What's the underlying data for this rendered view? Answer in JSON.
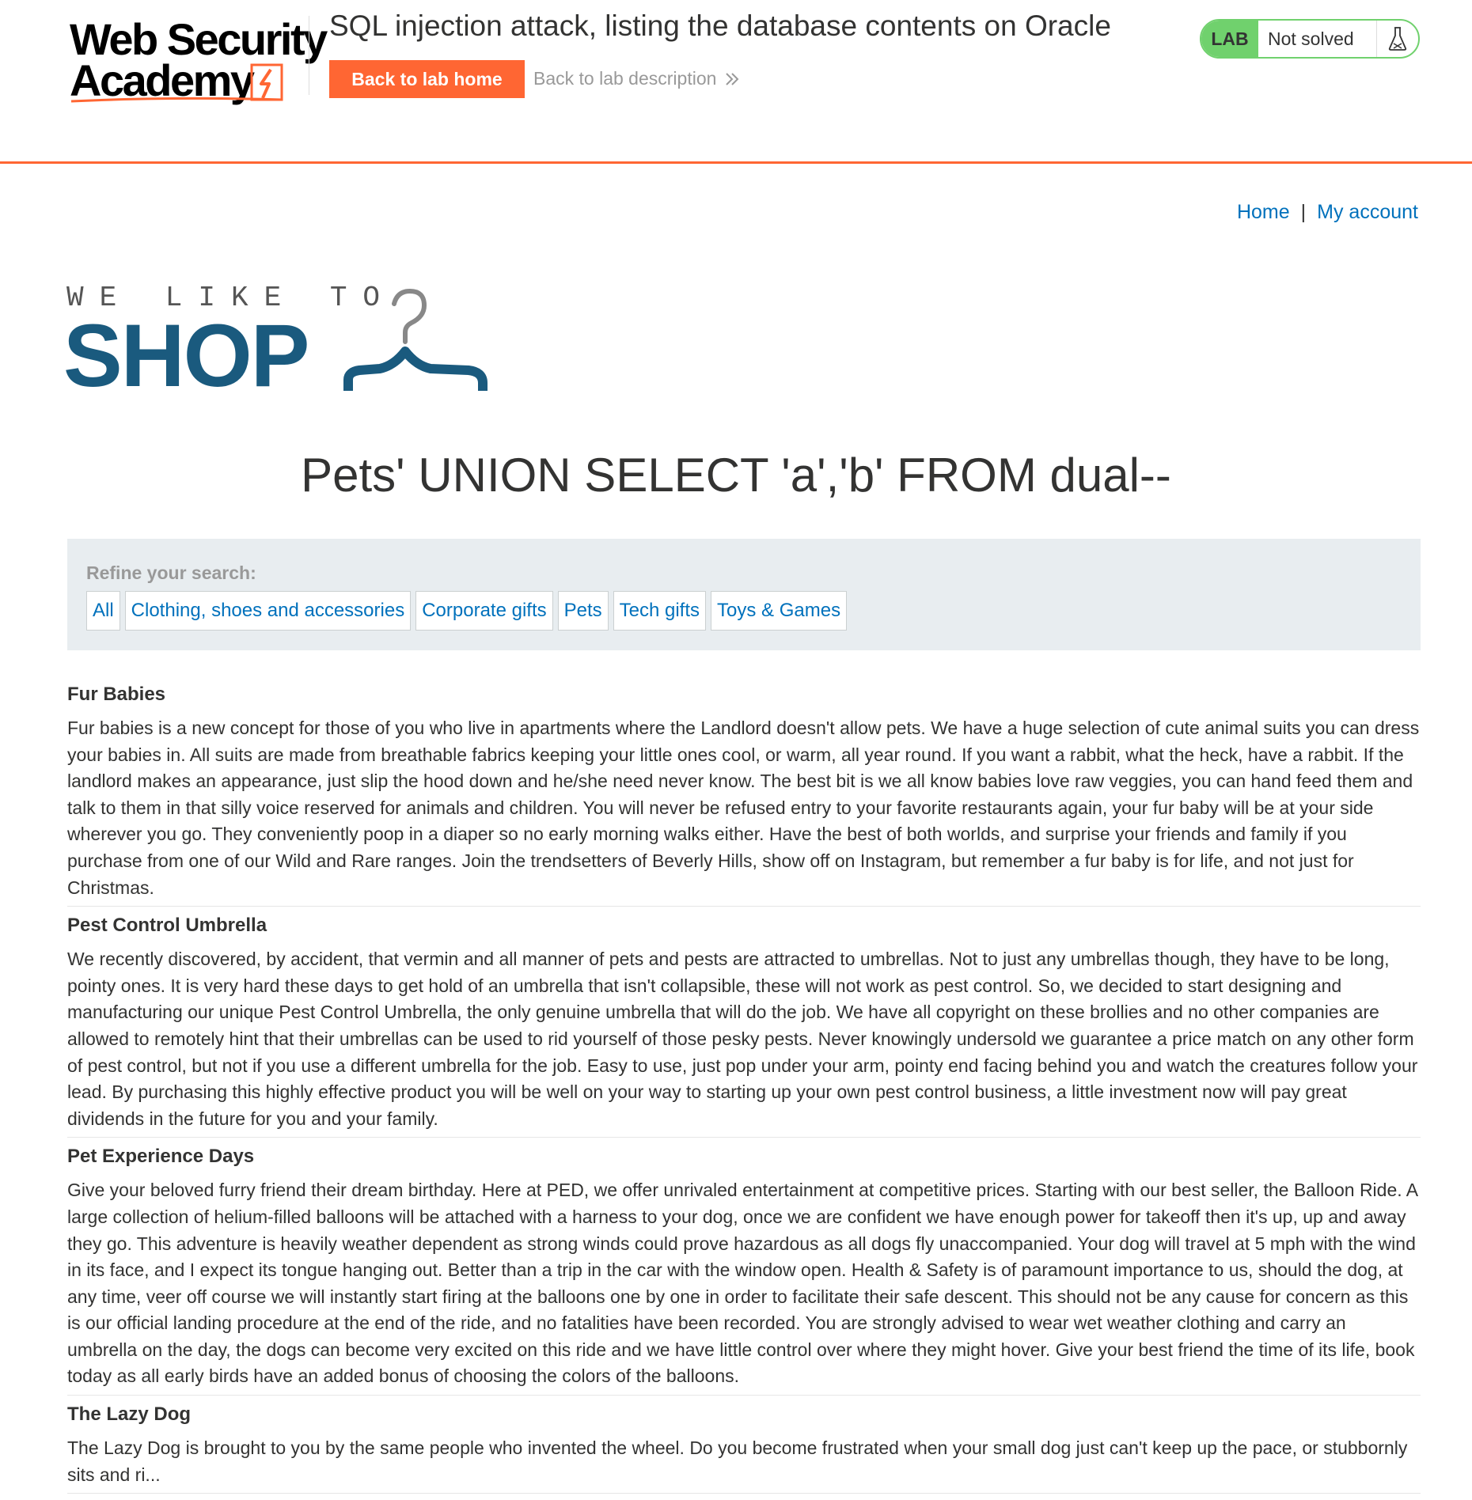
{
  "academy": {
    "logo_line1": "Web Security",
    "logo_line2": "Academy",
    "lab_title": "SQL injection attack, listing the database contents on Oracle",
    "back_home_label": "Back to lab home",
    "back_description_label": "Back to lab description",
    "lab_badge": "LAB",
    "lab_status": "Not solved",
    "icons": [
      "lightning-icon",
      "chevron-double-right-icon",
      "flask-icon"
    ],
    "colors": {
      "accent": "#ff6633",
      "status_green": "#70d16d"
    }
  },
  "nav": {
    "home": "Home",
    "separator": "|",
    "account": "My account",
    "link_color": "#0071bc"
  },
  "shop": {
    "tagline": "WE LIKE TO",
    "word": "SHOP",
    "icon": "hanger-icon",
    "color": "#1a5a7e"
  },
  "search": {
    "heading": "Pets' UNION SELECT 'a','b' FROM dual--"
  },
  "filters": {
    "label": "Refine your search:",
    "items": [
      "All",
      "Clothing, shoes and accessories",
      "Corporate gifts",
      "Pets",
      "Tech gifts",
      "Toys & Games"
    ]
  },
  "results": [
    {
      "title": "Fur Babies",
      "body": "Fur babies is a new concept for those of you who live in apartments where the Landlord doesn't allow pets. We have a huge selection of cute animal suits you can dress your babies in. All suits are made from breathable fabrics keeping your little ones cool, or warm, all year round. If you want a rabbit, what the heck, have a rabbit. If the landlord makes an appearance, just slip the hood down and he/she need never know. The best bit is we all know babies love raw veggies, you can hand feed them and talk to them in that silly voice reserved for animals and children. You will never be refused entry to your favorite restaurants again, your fur baby will be at your side wherever you go. They conveniently poop in a diaper so no early morning walks either. Have the best of both worlds, and surprise your friends and family if you purchase from one of our Wild and Rare ranges. Join the trendsetters of Beverly Hills, show off on Instagram, but remember a fur baby is for life, and not just for Christmas."
    },
    {
      "title": "Pest Control Umbrella",
      "body": "We recently discovered, by accident, that vermin and all manner of pets and pests are attracted to umbrellas. Not to just any umbrellas though, they have to be long, pointy ones. It is very hard these days to get hold of an umbrella that isn't collapsible, these will not work as pest control. So, we decided to start designing and manufacturing our unique Pest Control Umbrella, the only genuine umbrella that will do the job. We have all copyright on these brollies and no other companies are allowed to remotely hint that their umbrellas can be used to rid yourself of those pesky pests. Never knowingly undersold we guarantee a price match on any other form of pest control, but not if you use a different umbrella for the job. Easy to use, just pop under your arm, pointy end facing behind you and watch the creatures follow your lead. By purchasing this highly effective product you will be well on your way to starting up your own pest control business, a little investment now will pay great dividends in the future for you and your family."
    },
    {
      "title": "Pet Experience Days",
      "body": "Give your beloved furry friend their dream birthday. Here at PED, we offer unrivaled entertainment at competitive prices. Starting with our best seller, the Balloon Ride. A large collection of helium-filled balloons will be attached with a harness to your dog, once we are confident we have enough power for takeoff then it's up, up and away they go. This adventure is heavily weather dependent as strong winds could prove hazardous as all dogs fly unaccompanied. Your dog will travel at 5 mph with the wind in its face, and I expect its tongue hanging out. Better than a trip in the car with the window open. Health & Safety is of paramount importance to us, should the dog, at any time, veer off course we will instantly start firing at the balloons one by one in order to facilitate their safe descent. This should not be any cause for concern as this is our official landing procedure at the end of the ride, and no fatalities have been recorded. You are strongly advised to wear wet weather clothing and carry an umbrella on the day, the dogs can become very excited on this ride and we have little control over where they might hover. Give your best friend the time of its life, book today as all early birds have an added bonus of choosing the colors of the balloons."
    },
    {
      "title": "The Lazy Dog",
      "body": "The Lazy Dog is brought to you by the same people who invented the wheel. Do you become frustrated when your small dog just can't keep up the pace, or stubbornly sits and ri..."
    }
  ]
}
